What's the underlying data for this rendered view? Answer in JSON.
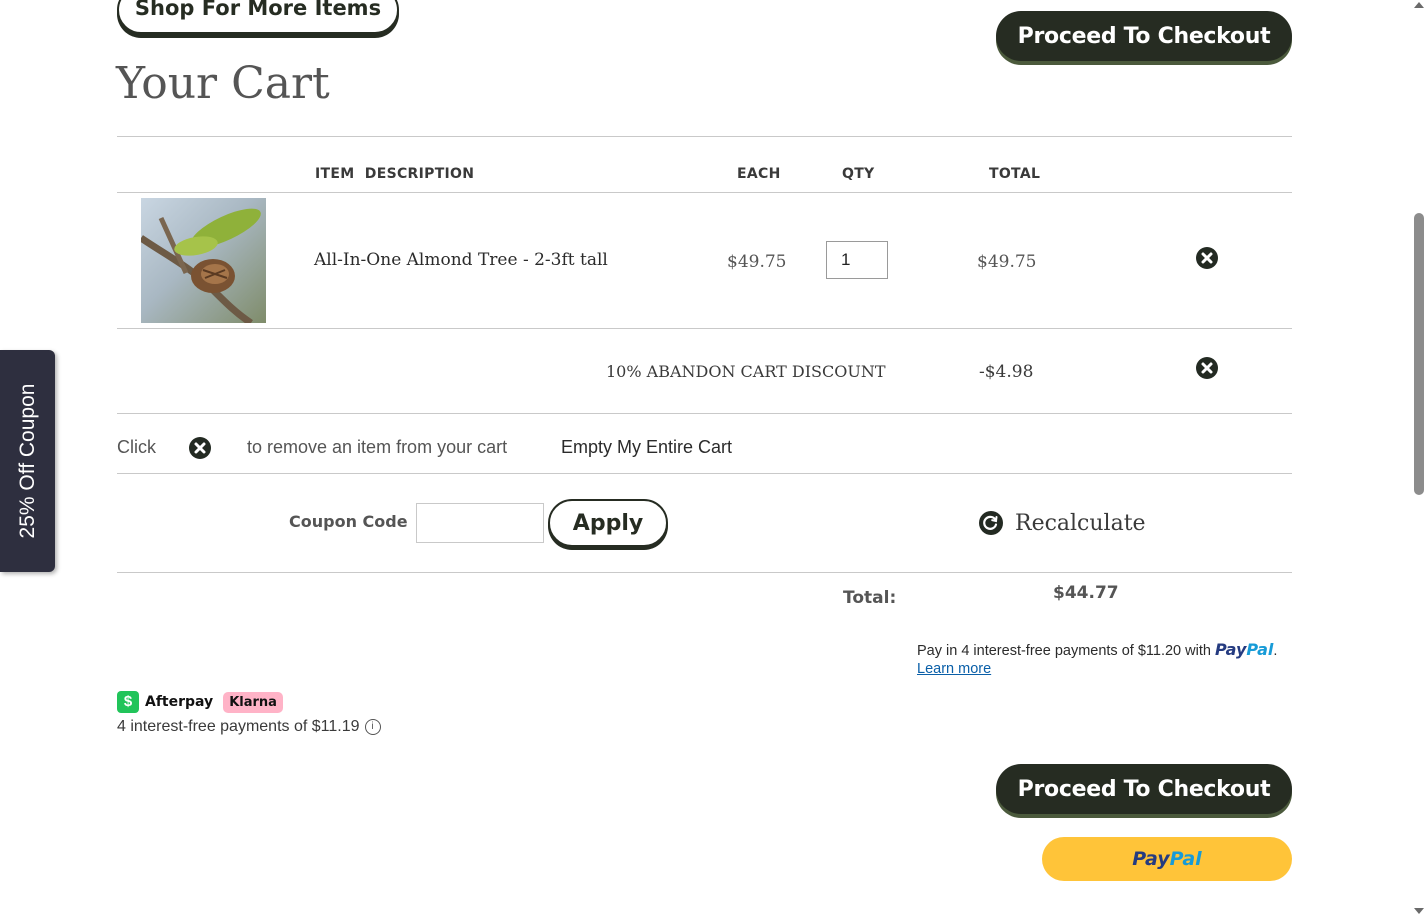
{
  "header": {
    "shop_more_label": "Shop For More Items",
    "checkout_label": "Proceed To Checkout",
    "page_title": "Your Cart"
  },
  "table": {
    "headers": {
      "description": "ITEM  DESCRIPTION",
      "each": "EACH",
      "qty": "QTY",
      "total": "TOTAL"
    },
    "item": {
      "name": "All-In-One Almond Tree - 2-3ft tall",
      "each": "$49.75",
      "qty": "1",
      "total": "$49.75"
    },
    "discount": {
      "label": "10% ABANDON CART DISCOUNT",
      "amount": "-$4.98"
    }
  },
  "remove_hint": {
    "click": "Click",
    "suffix": "to remove an item from your cart",
    "empty_cart": "Empty My Entire Cart"
  },
  "coupon": {
    "label": "Coupon Code",
    "value": "",
    "apply_label": "Apply",
    "recalculate_label": "Recalculate"
  },
  "totals": {
    "label": "Total:",
    "amount": "$44.77"
  },
  "paypal_offer": {
    "text": "Pay in 4 interest-free payments of $11.20 with",
    "brand_pay": "Pay",
    "brand_pal": "Pal",
    "period": ".",
    "learn_more": "Learn more"
  },
  "afterpay": {
    "afterpay_label": "Afterpay",
    "klarna_label": "Klarna",
    "installments_text": "4 interest-free payments of $11.19"
  },
  "footer": {
    "checkout_label": "Proceed To Checkout",
    "paypal_pay": "Pay",
    "paypal_pal": "Pal"
  },
  "side_tab": {
    "label": "25% Off Coupon"
  },
  "colors": {
    "dark_button": "#262c22",
    "paypal_yellow": "#ffc439",
    "paypal_dark_blue": "#253b80",
    "paypal_light_blue": "#179bd7",
    "afterpay_green": "#21c45a",
    "klarna_pink": "#ffb3c7"
  }
}
